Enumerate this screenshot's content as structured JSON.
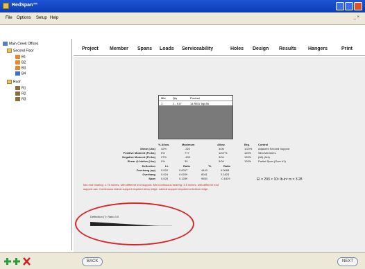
{
  "window": {
    "title": "RedSpan™"
  },
  "menu": {
    "items": [
      "File",
      "Options",
      "Setup",
      "Help"
    ],
    "mdi_controls": "_ ×"
  },
  "tree": {
    "root": "Main Creek Offices",
    "groups": [
      {
        "label": "Second Floor",
        "children": [
          "B1",
          "B2",
          "B3",
          "B4"
        ]
      },
      {
        "label": "Roof",
        "children": [
          "R1",
          "R2",
          "R3"
        ]
      }
    ]
  },
  "tabs": [
    "Project",
    "Member",
    "Spans",
    "Loads",
    "Serviceability",
    "Holes",
    "Design",
    "Results",
    "Hangers",
    "Print"
  ],
  "grid": {
    "headers": [
      "Mbr",
      "Qty",
      "Product"
    ],
    "row": [
      "1",
      "1 - 9.5\"",
      "14 RED Tsp 85"
    ]
  },
  "results": {
    "col_headers": [
      "% Allow.",
      "Maximum",
      "Allow.",
      "Brg.",
      "Control"
    ],
    "rows": [
      {
        "label": "Shear (Lbs)",
        "vals": [
          "42%",
          "-322",
          "3/06",
          "1/20%",
          "Adjacent Second Support"
        ]
      },
      {
        "label": "Positive Moment (Ft-lbs)",
        "vals": [
          "6%",
          "777",
          "1207%",
          "120%",
          "Slim Members"
        ]
      },
      {
        "label": "Negative Moment (Ft-lbs)",
        "vals": [
          "27%",
          "-490",
          "3/04",
          "120%",
          "(All) (Ant)"
        ]
      },
      {
        "label": "Shear @ Notice (Lbs)",
        "vals": [
          "0%",
          "30",
          "3/04",
          "120%",
          "Partial Span (Over #1)"
        ]
      }
    ],
    "deflection_headers": [
      "Deflection",
      "LL",
      "Ratio",
      "TL",
      "Ratio"
    ],
    "deflection_rows": [
      {
        "label": "Overhang (up)",
        "vals": [
          "0.020",
          "0.0007",
          "4443",
          "0.0083"
        ]
      },
      {
        "label": "Overhang",
        "vals": [
          "0.024",
          "0.0209",
          "8041",
          "0.1823"
        ]
      },
      {
        "label": "Span",
        "vals": [
          "0.028",
          "0.1289",
          "9650",
          "-0.1829"
        ]
      }
    ],
    "formula": "EI = 293 × 10⁶ lb-in²  m = 3.28"
  },
  "warnings": [
    "Min end bearing: 1.75 inches, with different end support. Min continuous bearing: 3.5 inches, with different end",
    "support use. Continuous lateral support required at top edge. Lateral support required at bottom edge."
  ],
  "deflection_chart": {
    "label": "Deflection (\"): Ratio   0.0",
    "level": 0.85
  },
  "nav": {
    "back": "BACK",
    "next": "NEXT"
  },
  "colors": {
    "accent_blue": "#1f55d6",
    "annotation_red": "#d8262a",
    "warning_red": "#c0282b"
  }
}
